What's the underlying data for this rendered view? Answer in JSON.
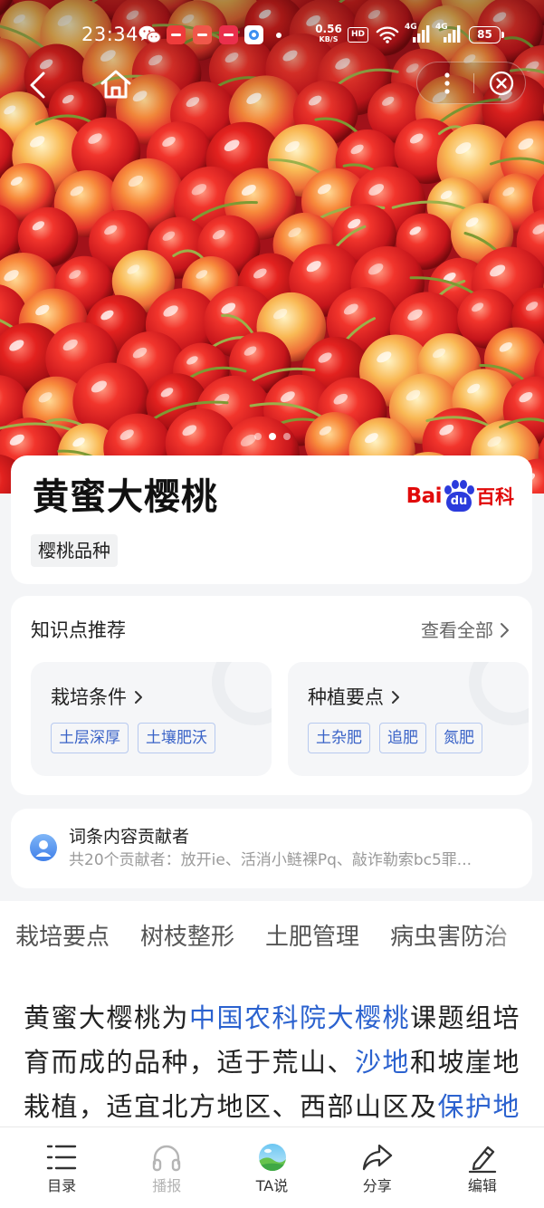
{
  "status_bar": {
    "time": "23:34",
    "net_speed": "0.56",
    "net_speed_unit": "KB/S",
    "hd_badge": "HD",
    "signal_1_type": "4G",
    "signal_2_type": "4G",
    "battery_level": "85",
    "notification_icons": [
      "wechat-icon",
      "app-icon",
      "app-icon",
      "app-icon",
      "app-icon",
      "more-dot-icon"
    ]
  },
  "nav": {
    "back_icon": "chevron-left-icon",
    "home_icon": "home-icon",
    "more_icon": "more-vertical-icon",
    "close_icon": "close-circle-icon"
  },
  "hero": {
    "carousel": {
      "pages": 3,
      "current": 2
    }
  },
  "entry": {
    "title": "黄蜜大樱桃",
    "category_tag": "樱桃品种",
    "logo": {
      "bai": "Bai",
      "du": "du",
      "baike": "百科"
    }
  },
  "knowledge": {
    "title": "知识点推荐",
    "view_all": "查看全部",
    "cards": [
      {
        "title": "栽培条件",
        "tags": [
          "土层深厚",
          "土壤肥沃"
        ]
      },
      {
        "title": "种植要点",
        "tags": [
          "土杂肥",
          "追肥",
          "氮肥"
        ]
      }
    ]
  },
  "contributors": {
    "title": "词条内容贡献者",
    "summary": "共20个贡献者：放开ie、活消小鲢裸Pq、敲诈勒索bc5罪..."
  },
  "section_tabs": [
    "栽培要点",
    "树枝整形",
    "土肥管理",
    "病虫害防治"
  ],
  "intro": {
    "segments": [
      {
        "text": "黄蜜大樱桃为",
        "link": false
      },
      {
        "text": "中国农科院大樱桃",
        "link": true
      },
      {
        "text": "课题组培育而成的品种，适于荒山、",
        "link": false
      },
      {
        "text": "沙地",
        "link": true
      },
      {
        "text": "和坡崖地栽植，适宜北方地区、西部山区及",
        "link": false
      },
      {
        "text": "保护地",
        "link": true
      }
    ]
  },
  "bottom_bar": {
    "items": [
      {
        "label": "目录",
        "icon": "list-icon"
      },
      {
        "label": "播报",
        "icon": "headphones-icon",
        "disabled": true
      },
      {
        "label": "TA说",
        "icon": "ta-say-icon"
      },
      {
        "label": "分享",
        "icon": "share-icon"
      },
      {
        "label": "编辑",
        "icon": "edit-icon"
      }
    ]
  },
  "colors": {
    "link": "#2b62cf",
    "tag_text": "#3a63c7",
    "tag_border": "#b7c9ef",
    "baidu_red": "#e10a0a",
    "baidu_blue": "#2b3bdc",
    "page_bg": "#f4f5f7"
  }
}
